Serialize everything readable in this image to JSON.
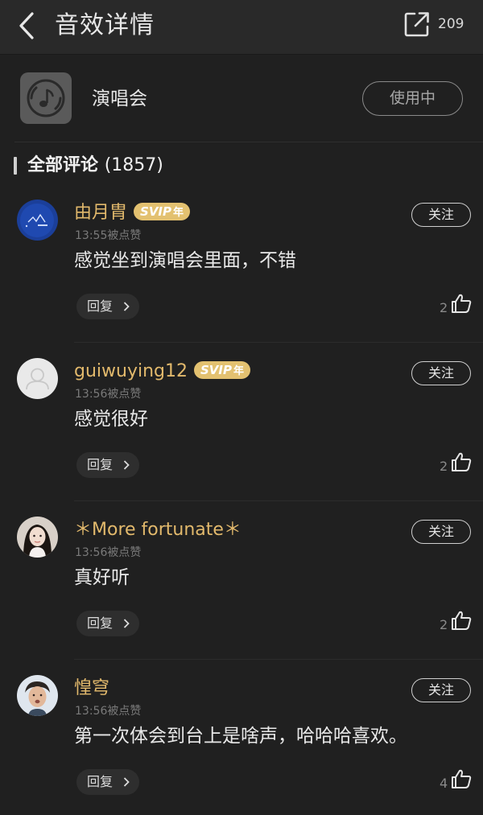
{
  "header": {
    "title": "音效详情",
    "share_count": "209"
  },
  "effect": {
    "name": "演唱会",
    "action_label": "使用中"
  },
  "comments_section": {
    "title": "全部评论",
    "count": "(1857)"
  },
  "comments": [
    {
      "username": "由月胄",
      "svip": true,
      "svip_label": "SVIP",
      "svip_year": "年",
      "time": "13:55被点赞",
      "follow_label": "关注",
      "text": "感觉坐到演唱会里面，不错",
      "reply_label": "回复",
      "likes": "2",
      "avatar": "dark-blue-logo"
    },
    {
      "username": "guiwuying12",
      "svip": true,
      "svip_label": "SVIP",
      "svip_year": "年",
      "time": "13:56被点赞",
      "follow_label": "关注",
      "text": "感觉很好",
      "reply_label": "回复",
      "likes": "2",
      "avatar": "default-person"
    },
    {
      "username": "＊More fortunate＊",
      "svip": false,
      "time": "13:56被点赞",
      "follow_label": "关注",
      "text": "真好听",
      "reply_label": "回复",
      "likes": "2",
      "avatar": "girl-photo"
    },
    {
      "username": "惶穹",
      "svip": false,
      "time": "13:56被点赞",
      "follow_label": "关注",
      "text": "第一次体会到台上是啥声，哈哈哈喜欢。",
      "reply_label": "回复",
      "likes": "4",
      "avatar": "boy-photo"
    }
  ],
  "colors": {
    "background": "#202020",
    "username": "#e2b96c",
    "svip_badge": "#e3c170"
  }
}
